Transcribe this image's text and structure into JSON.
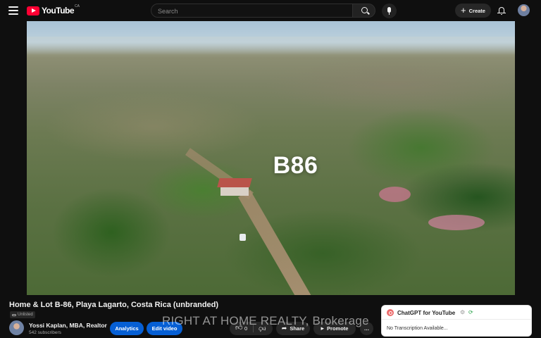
{
  "header": {
    "logo_text": "YouTube",
    "country_code": "CA",
    "search_placeholder": "Search",
    "create_label": "Create",
    "plus_glyph": "+",
    "icons": [
      "menu-icon",
      "search-icon",
      "mic-icon",
      "bell-icon",
      "avatar"
    ]
  },
  "video": {
    "overlay_label": "B86",
    "watermark": "RIGHT AT HOME REALTY, Brokerage"
  },
  "meta": {
    "title": "Home & Lot B-86, Playa Lagarto, Costa Rica (unbranded)",
    "visibility": "Unlisted",
    "channel_name": "Yossi Kaplan, MBA, Realtor",
    "subscribers": "542 subscribers",
    "analytics_label": "Analytics",
    "edit_label": "Edit video",
    "like_count": "0",
    "share_label": "Share",
    "promote_label": "Promote",
    "more_glyph": "…"
  },
  "chatgpt_panel": {
    "title": "ChatGPT for YouTube",
    "message": "No Transcription Available...",
    "accent": "#ec6b6b"
  },
  "colors": {
    "background": "#0f0f0f",
    "brand_red": "#ff0033",
    "button_blue": "#065fd4"
  }
}
